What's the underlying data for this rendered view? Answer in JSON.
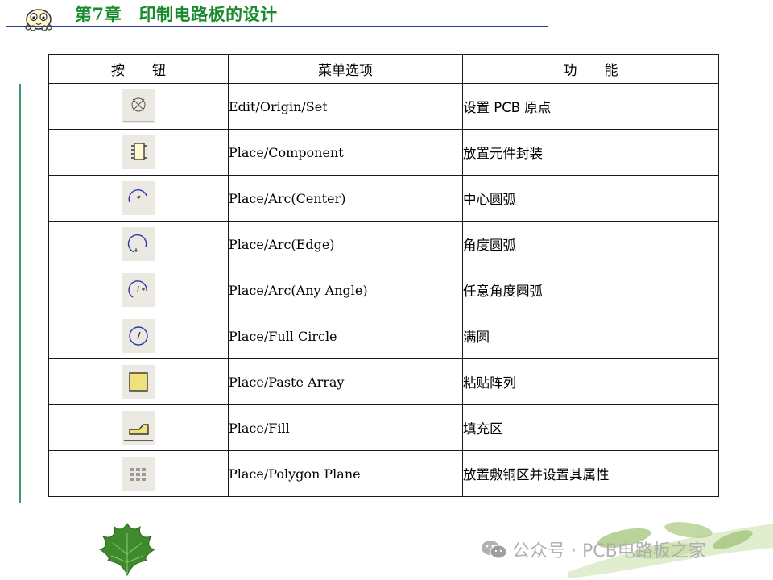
{
  "header": {
    "title": "第7章　印制电路板的设计",
    "title_color": "#1a8a2e",
    "rule_color": "#2b3d9a"
  },
  "table": {
    "columns": [
      "按　　钮",
      "菜单选项",
      "功　　能"
    ],
    "rows": [
      {
        "icon": "origin-set-icon",
        "menu": "Edit/Origin/Set",
        "function": "设置 PCB 原点"
      },
      {
        "icon": "component-icon",
        "menu": "Place/Component",
        "function": "放置元件封装"
      },
      {
        "icon": "arc-center-icon",
        "menu": "Place/Arc(Center)",
        "function": "中心圆弧"
      },
      {
        "icon": "arc-edge-icon",
        "menu": "Place/Arc(Edge)",
        "function": "角度圆弧"
      },
      {
        "icon": "arc-any-angle-icon",
        "menu": "Place/Arc(Any Angle)",
        "function": "任意角度圆弧"
      },
      {
        "icon": "full-circle-icon",
        "menu": "Place/Full Circle",
        "function": "满圆"
      },
      {
        "icon": "paste-array-icon",
        "menu": "Place/Paste Array",
        "function": "粘贴阵列"
      },
      {
        "icon": "fill-icon",
        "menu": "Place/Fill",
        "function": "填充区"
      },
      {
        "icon": "polygon-plane-icon",
        "menu": "Place/Polygon Plane",
        "function": "放置敷铜区并设置其属性"
      }
    ]
  },
  "watermark": {
    "text": "公众号 · PCB电路板之家"
  }
}
